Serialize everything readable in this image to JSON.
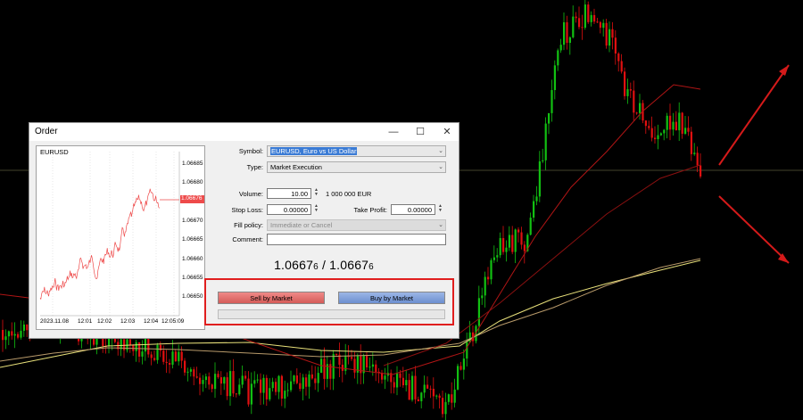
{
  "dialog": {
    "title": "Order",
    "minimize": "—",
    "maximize": "☐",
    "close": "✕"
  },
  "mini_chart": {
    "symbol": "EURUSD",
    "y_ticks": [
      "1.06685",
      "1.06680",
      "1.06675",
      "1.06670",
      "1.06665",
      "1.06660",
      "1.06655",
      "1.06650"
    ],
    "current_price_tag": "1.06676",
    "x_ticks": [
      "2023.11.08",
      "12:01",
      "12:02",
      "12:03",
      "12:04",
      "12:05:09"
    ]
  },
  "form": {
    "symbol_label": "Symbol:",
    "symbol_value": "EURUSD, Euro vs US Dollar",
    "type_label": "Type:",
    "type_value": "Market Execution",
    "volume_label": "Volume:",
    "volume_value": "10.00",
    "volume_units": "1 000 000 EUR",
    "stop_loss_label": "Stop Loss:",
    "stop_loss_value": "0.00000",
    "take_profit_label": "Take Profit:",
    "take_profit_value": "0.00000",
    "fill_policy_label": "Fill policy:",
    "fill_policy_value": "Immediate or Cancel",
    "comment_label": "Comment:",
    "comment_value": ""
  },
  "quote": {
    "bid_main": "1.0667",
    "bid_small": "6",
    "separator": " / ",
    "ask_main": "1.0667",
    "ask_small": "6"
  },
  "buttons": {
    "sell": "Sell by Market",
    "buy": "Buy by Market"
  },
  "colors": {
    "highlight": "#e01e1e",
    "bull": "#12c012",
    "bear": "#e01010",
    "annotation_arrow": "#d41a1a"
  }
}
